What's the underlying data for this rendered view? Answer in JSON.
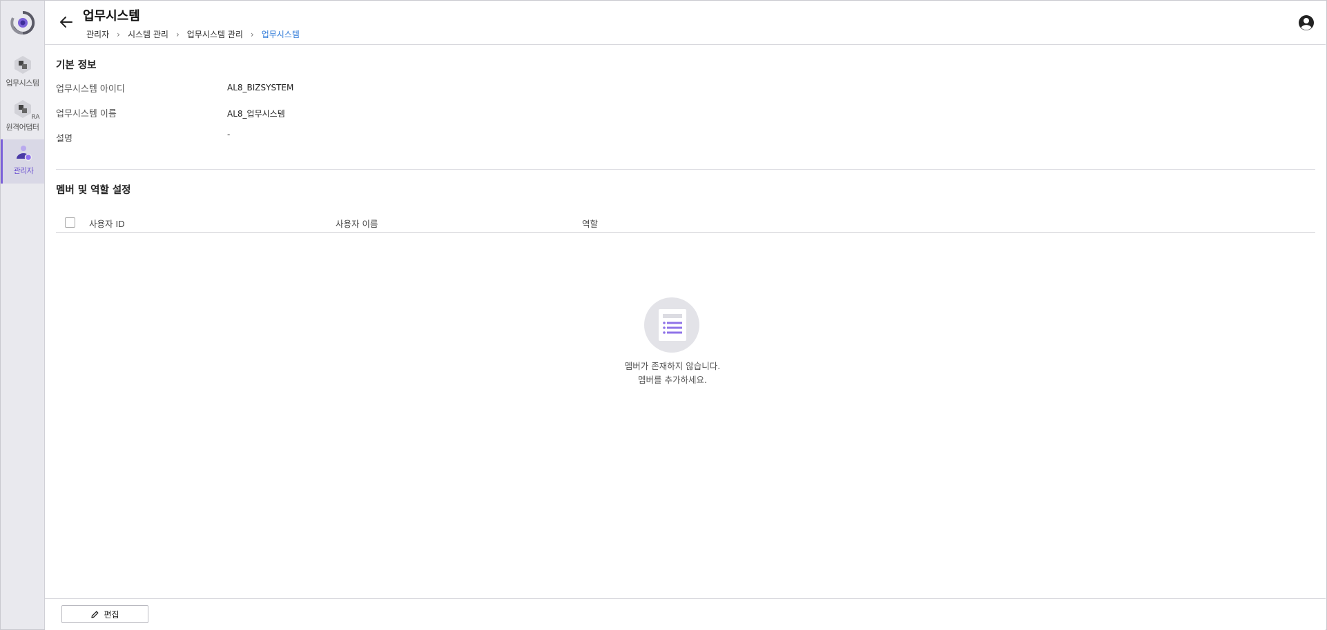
{
  "sidebar": {
    "items": [
      {
        "label": "업무시스템",
        "icon": "business-system-icon"
      },
      {
        "label": "원격어댑터",
        "icon": "remote-adapter-icon",
        "tag": "RA"
      },
      {
        "label": "관리자",
        "icon": "admin-user-icon",
        "active": true
      }
    ]
  },
  "header": {
    "title": "업무시스템",
    "breadcrumb": [
      "관리자",
      "시스템 관리",
      "업무시스템 관리",
      "업무시스템"
    ]
  },
  "basic_info": {
    "title": "기본 정보",
    "fields": [
      {
        "label": "업무시스템 아이디",
        "value": "AL8_BIZSYSTEM"
      },
      {
        "label": "업무시스템 이름",
        "value": "AL8_업무시스템"
      },
      {
        "label": "설명",
        "value": "-"
      }
    ]
  },
  "members": {
    "title": "멤버 및 역할 설정",
    "columns": [
      "사용자 ID",
      "사용자 이름",
      "역할"
    ],
    "empty_line1": "멤버가 존재하지 않습니다.",
    "empty_line2": "멤버를 추가하세요."
  },
  "footer": {
    "edit_label": "편집"
  },
  "colors": {
    "accent": "#7b61d9",
    "link": "#2f7ad8"
  }
}
